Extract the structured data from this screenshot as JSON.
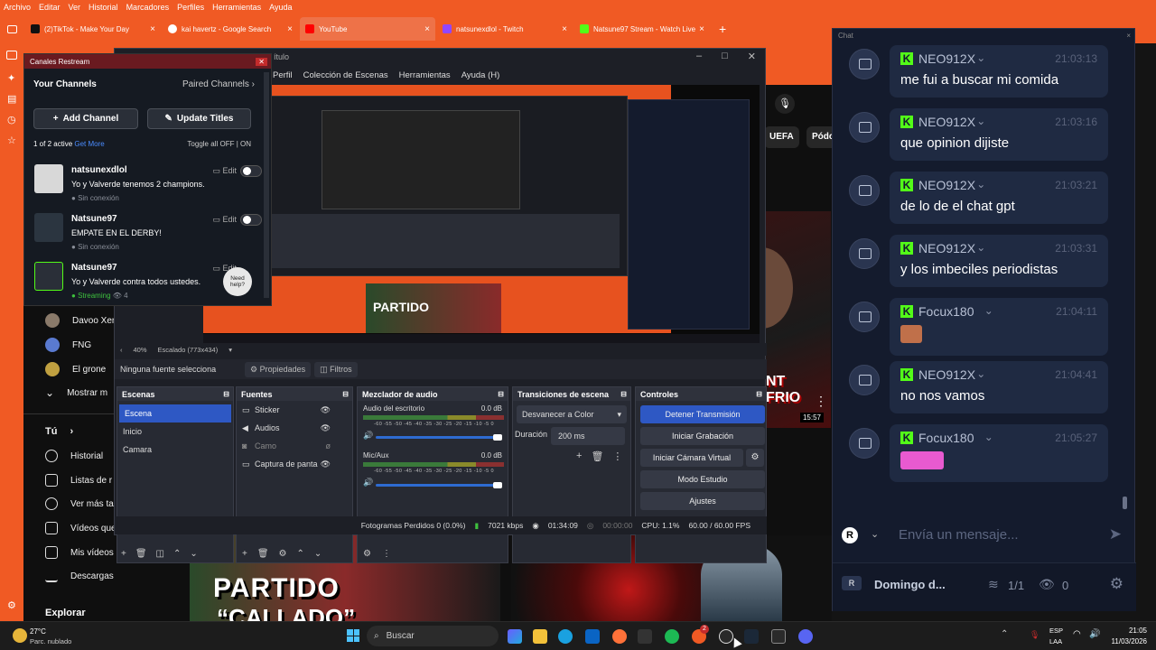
{
  "browser": {
    "menu": [
      "Archivo",
      "Editar",
      "Ver",
      "Historial",
      "Marcadores",
      "Perfiles",
      "Herramientas",
      "Ayuda"
    ],
    "tabs": [
      {
        "label": "(2)TikTok - Make Your Day",
        "color": "#111111"
      },
      {
        "label": "kai havertz - Google Search",
        "color": "#4285f4"
      },
      {
        "label": "YouTube",
        "color": "#ff0000"
      },
      {
        "label": "natsunexdlol - Twitch",
        "color": "#9146ff"
      },
      {
        "label": "Natsune97 Stream - Watch Live",
        "color": "#53fc18"
      }
    ],
    "new_tab": "+",
    "close": "×"
  },
  "youtube": {
    "chips": [
      "UEFA",
      "Pódc"
    ],
    "subscriptions": [
      {
        "label": "Davoo Xen"
      },
      {
        "label": "FNG"
      },
      {
        "label": "El grone"
      }
    ],
    "show_more": "Mostrar m",
    "you_section": "Tú",
    "nav": [
      "Historial",
      "Listas de r",
      "Ver más ta",
      "Vídeos que",
      "Mis vídeos",
      "Descargas"
    ],
    "explore": "Explorar",
    "thumb_text_1": "PARTIDO",
    "thumb_text_2": "“CALLADO”",
    "thumb_side": "NT\nFRIO",
    "duration": "15:57"
  },
  "restream": {
    "window_title": "Canales Restream",
    "your_channels": "Your Channels",
    "paired_channels": "Paired Channels",
    "add_channel": "Add Channel",
    "update_titles": "Update Titles",
    "active_count": "1 of 2 active",
    "get_more": "Get More",
    "toggle_all": "Toggle all",
    "off": "OFF",
    "on": "ON",
    "edit": "Edit",
    "need_help": "Need help?",
    "channels": [
      {
        "name": "natsunexdlol",
        "message": "Yo y Valverde tenemos 2 champions.",
        "status": "Sin conexión"
      },
      {
        "name": "Natsune97",
        "message": "EMPATE EN EL DERBY!",
        "status": "Sin conexión"
      },
      {
        "name": "Natsune97",
        "message": "Yo y Valverde contra todos ustedes.",
        "status": "Streaming",
        "viewers": "4"
      }
    ]
  },
  "obs": {
    "title_fragment": "ítulo",
    "menu": [
      "Perfil",
      "Colección de Escenas",
      "Herramientas",
      "Ayuda (H)"
    ],
    "zoom": "40%",
    "scaling": "Escalado (773x434)",
    "no_source": "Ninguna fuente selecciona",
    "properties": "Propiedades",
    "filters": "Filtros",
    "scenes_title": "Escenas",
    "scenes": [
      "Escena",
      "Inicio",
      "Camara"
    ],
    "sources_title": "Fuentes",
    "sources": [
      "Sticker",
      "Audios",
      "Camo",
      "Captura de panta"
    ],
    "mixer_title": "Mezclador de audio",
    "mixer": [
      {
        "name": "Audio del escritorio",
        "db": "0.0 dB"
      },
      {
        "name": "Mic/Aux",
        "db": "0.0 dB"
      }
    ],
    "scale_ticks": "-60 -55 -50 -45 -40 -35 -30 -25 -20 -15 -10 -5 0",
    "transitions_title": "Transiciones de escena",
    "transition": "Desvanecer a Color",
    "duration_label": "Duración",
    "duration_value": "200 ms",
    "controls_title": "Controles",
    "controls": [
      "Detener Transmisión",
      "Iniciar Grabación",
      "Iniciar Cámara Virtual",
      "Modo Estudio",
      "Ajustes"
    ],
    "status": {
      "dropped": "Fotogramas Perdidos 0 (0.0%)",
      "kbps": "7021 kbps",
      "stream_time": "01:34:09",
      "rec_time": "00:00:00",
      "cpu": "CPU: 1.1%",
      "fps": "60.00 / 60.00 FPS"
    }
  },
  "chat": {
    "title": "Chat",
    "messages": [
      {
        "user": "NEO912X",
        "time": "21:03:13",
        "text": "me fui a buscar mi comida"
      },
      {
        "user": "NEO912X",
        "time": "21:03:16",
        "text": "que opinion dijiste"
      },
      {
        "user": "NEO912X",
        "time": "21:03:21",
        "text": "de lo de el chat gpt"
      },
      {
        "user": "NEO912X",
        "time": "21:03:31",
        "text": "y los imbeciles periodistas"
      },
      {
        "user": "Focux180",
        "time": "21:04:11",
        "text": "",
        "emote": "face-emote"
      },
      {
        "user": "NEO912X",
        "time": "21:04:41",
        "text": "no nos vamos"
      },
      {
        "user": "Focux180",
        "time": "21:05:27",
        "text": "",
        "emote": "pink-emote"
      }
    ],
    "input_placeholder": "Envía un mensaje...",
    "stream_name": "Domingo d...",
    "ratio": "1/1",
    "viewers": "0",
    "kick_color": "#53fc18"
  },
  "taskbar": {
    "weather_temp": "27°C",
    "weather_desc": "Parc. nublado",
    "search": "Buscar",
    "lang": "ESP",
    "lang2": "LAA",
    "time": "21:05",
    "date": "11/03/2026",
    "badge_2": "2"
  }
}
